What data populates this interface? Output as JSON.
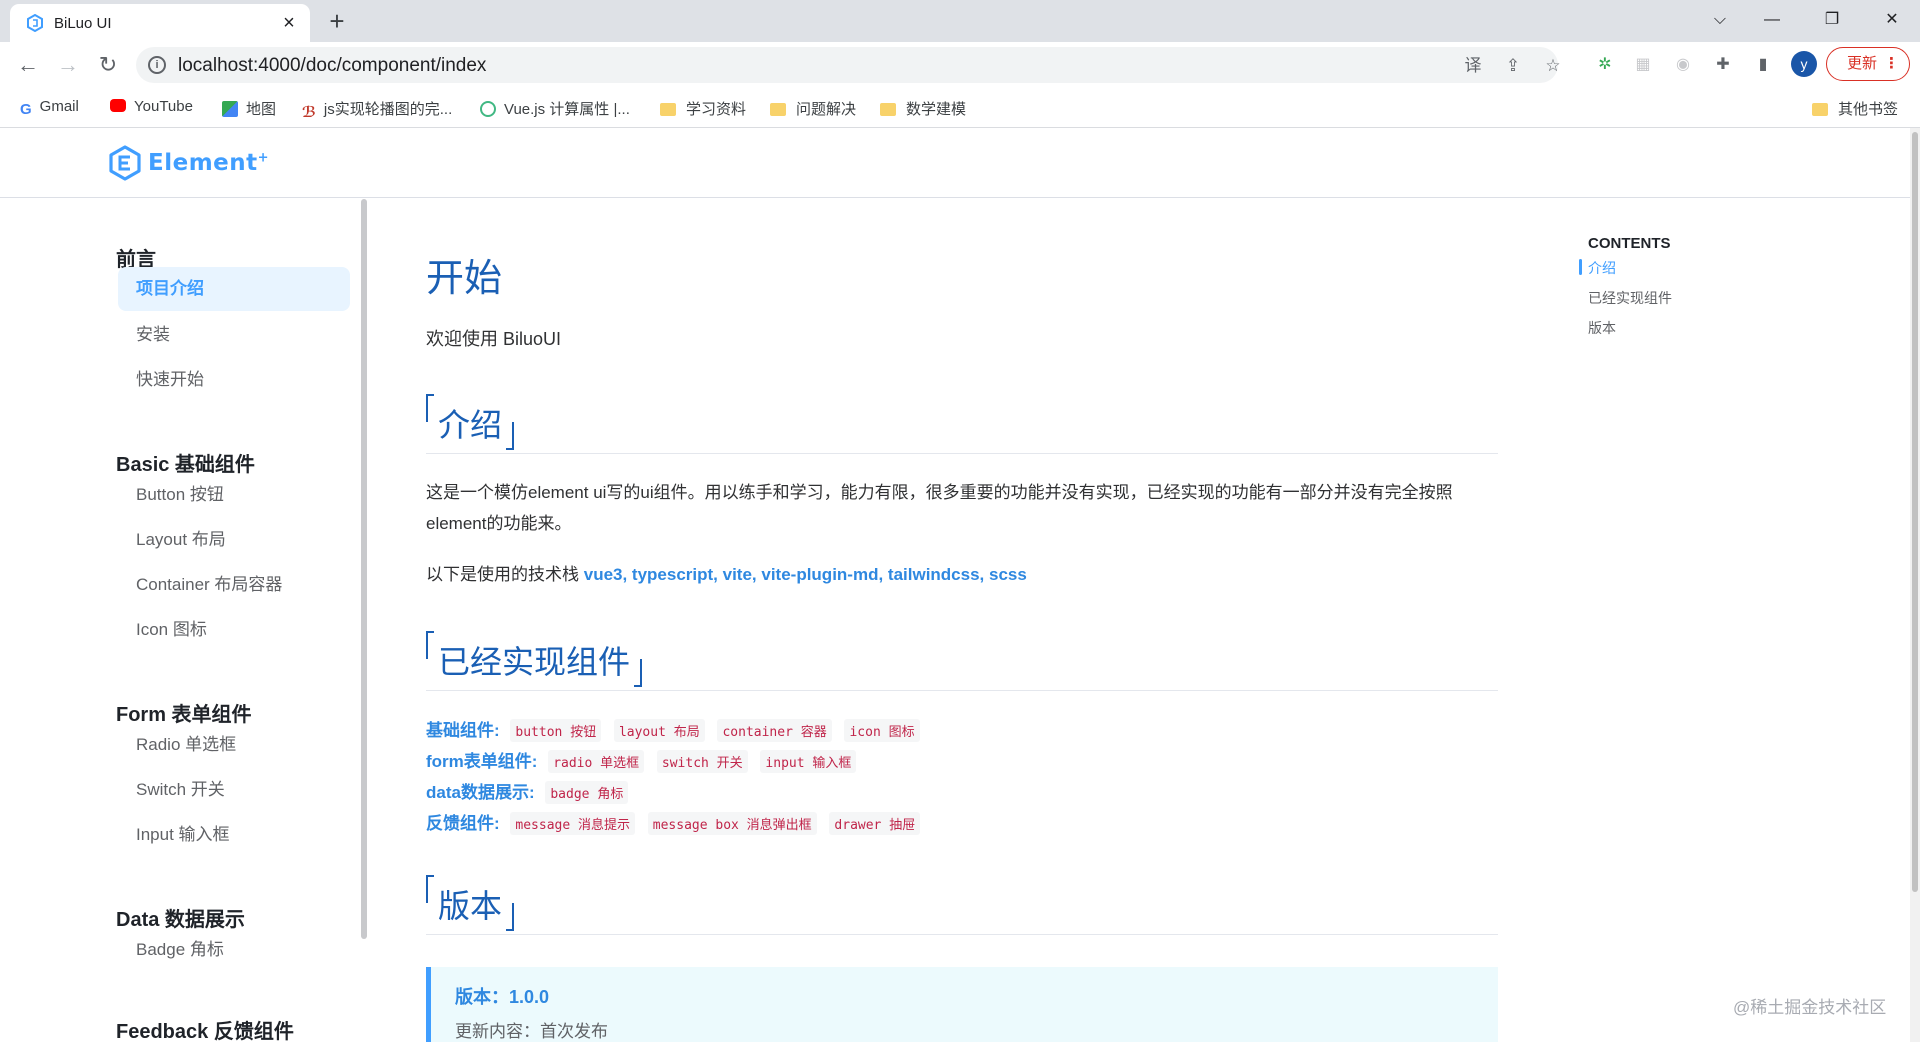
{
  "browser": {
    "tab_title": "BiLuo UI",
    "url": "localhost:4000/doc/component/index",
    "update_label": "更新",
    "avatar_initial": "y",
    "bookmarks": [
      {
        "label": "Gmail",
        "icon": "google-icon"
      },
      {
        "label": "YouTube",
        "icon": "youtube-icon"
      },
      {
        "label": "地图",
        "icon": "maps-icon"
      },
      {
        "label": "js实现轮播图的完...",
        "icon": "site-icon"
      },
      {
        "label": "Vue.js 计算属性 |...",
        "icon": "vue-icon"
      },
      {
        "label": "学习资料",
        "icon": "folder-icon"
      },
      {
        "label": "问题解决",
        "icon": "folder-icon"
      },
      {
        "label": "数学建模",
        "icon": "folder-icon"
      }
    ],
    "other_bookmarks": "其他书签"
  },
  "site": {
    "logo_text": "Element",
    "logo_sup": "+"
  },
  "sidebar": {
    "groups": [
      {
        "title": "前言",
        "items": [
          "项目介绍",
          "安装",
          "快速开始"
        ]
      },
      {
        "title": "Basic 基础组件",
        "items": [
          "Button 按钮",
          "Layout 布局",
          "Container 布局容器",
          "Icon 图标"
        ]
      },
      {
        "title": "Form 表单组件",
        "items": [
          "Radio 单选框",
          "Switch 开关",
          "Input 输入框"
        ]
      },
      {
        "title": "Data 数据展示",
        "items": [
          "Badge 角标"
        ]
      },
      {
        "title": "Feedback 反馈组件",
        "items": []
      }
    ],
    "active_item": "项目介绍"
  },
  "content": {
    "title": "开始",
    "lead": "欢迎使用 BiluoUI",
    "section_intro": "介绍",
    "intro_text": "这是一个模仿element ui写的ui组件。用以练手和学习，能力有限，很多重要的功能并没有实现，已经实现的功能有一部分并没有完全按照element的功能来。",
    "stack_prefix": "以下是使用的技术栈 ",
    "stack": "vue3, typescript, vite, vite-plugin-md, tailwindcss, scss",
    "section_components": "已经实现组件",
    "features": [
      {
        "label": "基础组件:",
        "tags": [
          "button 按钮",
          "layout 布局",
          "container 容器",
          "icon 图标"
        ]
      },
      {
        "label": "form表单组件:",
        "tags": [
          "radio 单选框",
          "switch 开关",
          "input 输入框"
        ]
      },
      {
        "label": "data数据展示:",
        "tags": [
          "badge 角标"
        ]
      },
      {
        "label": "反馈组件:",
        "tags": [
          "message 消息提示",
          "message box 消息弹出框",
          "drawer 抽屉"
        ]
      }
    ],
    "section_version": "版本",
    "version_label": "版本：1.0.0",
    "version_note": "更新内容：首次发布"
  },
  "toc": {
    "title": "CONTENTS",
    "items": [
      "介绍",
      "已经实现组件",
      "版本"
    ],
    "active": "介绍"
  },
  "watermark": "@稀土掘金技术社区",
  "colors": {
    "accent": "#409eff",
    "heading": "#1a5fb4",
    "tag_text": "#c0254a"
  }
}
